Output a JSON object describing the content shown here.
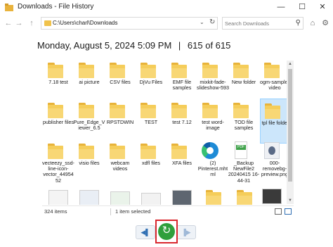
{
  "window": {
    "title": "Downloads - File History",
    "minimize": "—",
    "maximize": "☐",
    "close": "✕"
  },
  "nav": {
    "back": "←",
    "forward": "→",
    "up": "↑"
  },
  "address": {
    "path": "C:\\Users\\charl\\Downloads",
    "chevron": "⌄",
    "refresh": "↻"
  },
  "search": {
    "placeholder": "Search Downloads",
    "icon": "⚲"
  },
  "toolbar": {
    "home": "⌂",
    "settings": "⚙"
  },
  "header": {
    "date": "Monday, August 5, 2024 5:09 PM",
    "separator": "|",
    "position": "615 of 615"
  },
  "items_row1": [
    "7.18 test",
    "ai picture",
    "CSV files",
    "DjVu Files",
    "EMF file samples",
    "mixkit-fade-slideshow-593",
    "New folder",
    "ogm-sample-video"
  ],
  "items_row2": [
    "publisher files",
    "Pure_Edge_Viewer_6.5",
    "RPSTDWIN",
    "TEST",
    "test 7.12",
    "test word-image",
    "TOD file samples",
    "tpl file folder"
  ],
  "items_row3": [
    "vecteezy_ssd-line-icon-vector_4495452",
    "visio files",
    "webcam videos",
    "xdfl files",
    "XFA files",
    "(2) Pinterest.mhtml",
    "_Backup NewFile2 20240415 16-44-31",
    "000-removebg-preview.png"
  ],
  "pdf_badge": "PDF",
  "status": {
    "count": "324 items",
    "selected": "1 item selected"
  },
  "controls": {
    "previous": "◀▌",
    "restore": "↻",
    "next": "▐▶"
  },
  "scrollbar": {
    "up": "▲",
    "down": "▼"
  },
  "colors": {
    "folder": "#f5cd5a",
    "selection": "#cce6fb",
    "restore_button": "#2f9f3c",
    "highlight_box": "#d9272e"
  }
}
